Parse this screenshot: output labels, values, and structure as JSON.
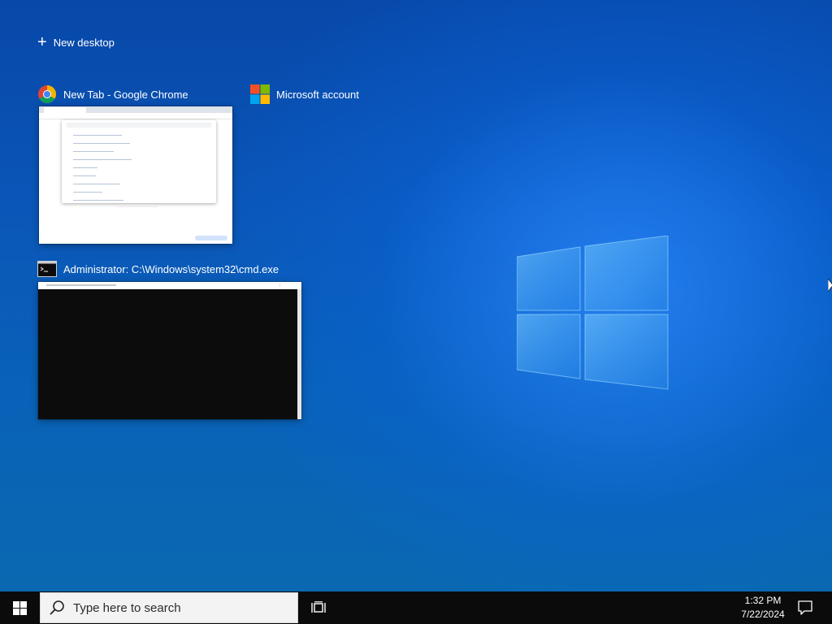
{
  "task_view": {
    "new_desktop_label": "New desktop",
    "windows": [
      {
        "title": "New Tab - Google Chrome",
        "icon": "chrome-icon"
      },
      {
        "title": "Microsoft account",
        "icon": "microsoft-logo-icon"
      },
      {
        "title": "Administrator: C:\\Windows\\system32\\cmd.exe",
        "icon": "cmd-icon"
      }
    ]
  },
  "taskbar": {
    "search_placeholder": "Type here to search",
    "time": "1:32 PM",
    "date": "7/22/2024",
    "icons": [
      "windows-start-icon",
      "search-icon",
      "task-view-icon",
      "notification-icon"
    ]
  },
  "colors": {
    "desktop_blue": "#0a56b8",
    "taskbar": "#0b0b0b",
    "chrome_red": "#db4437",
    "chrome_yellow": "#f4b400",
    "chrome_green": "#0f9d58",
    "chrome_blue": "#4285f4",
    "ms_red": "#f25022",
    "ms_green": "#7fba00",
    "ms_blue": "#00a4ef",
    "ms_yellow": "#ffb900"
  }
}
